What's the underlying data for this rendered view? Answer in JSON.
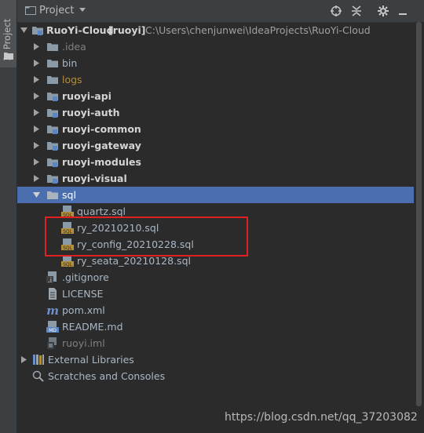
{
  "sidebar": {
    "tab_label": "1: Project"
  },
  "header": {
    "title": "Project"
  },
  "root": {
    "name": "RuoYi-Cloud",
    "module": "[ruoyi]",
    "path": "C:\\Users\\chenjunwei\\IdeaProjects\\RuoYi-Cloud"
  },
  "tree": [
    {
      "label": ".idea"
    },
    {
      "label": "bin"
    },
    {
      "label": "logs"
    },
    {
      "label": "ruoyi-api"
    },
    {
      "label": "ruoyi-auth"
    },
    {
      "label": "ruoyi-common"
    },
    {
      "label": "ruoyi-gateway"
    },
    {
      "label": "ruoyi-modules"
    },
    {
      "label": "ruoyi-visual"
    },
    {
      "label": "sql"
    },
    {
      "label": "quartz.sql"
    },
    {
      "label": "ry_20210210.sql"
    },
    {
      "label": "ry_config_20210228.sql"
    },
    {
      "label": "ry_seata_20210128.sql"
    },
    {
      "label": ".gitignore"
    },
    {
      "label": "LICENSE"
    },
    {
      "label": "pom.xml"
    },
    {
      "label": "README.md"
    },
    {
      "label": "ruoyi.iml"
    },
    {
      "label": "External Libraries"
    },
    {
      "label": "Scratches and Consoles"
    }
  ],
  "watermark": "https://blog.csdn.net/qq_37203082",
  "colors": {
    "selection": "#4b6eaf",
    "highlight_box": "#e02020",
    "folder": "#8a9aa6",
    "module_folder": "#5a86c6"
  }
}
